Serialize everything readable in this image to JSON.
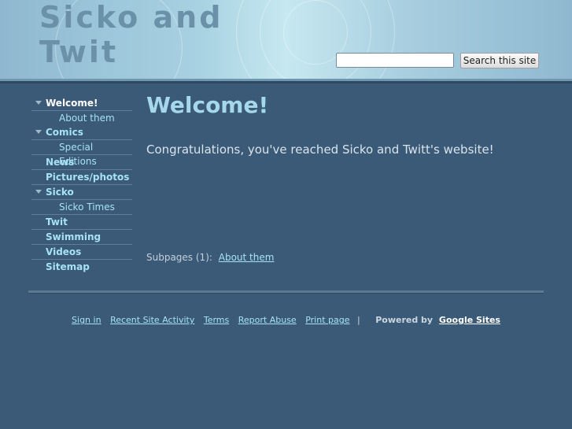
{
  "site": {
    "title": "Sicko and Twit"
  },
  "search": {
    "placeholder": "",
    "button_label": "Search this site"
  },
  "nav": {
    "items": [
      {
        "label": "Welcome!",
        "expanded": true
      },
      {
        "label": "About them"
      },
      {
        "label": "Comics",
        "expanded": true
      },
      {
        "label": "Special Editions"
      },
      {
        "label": "News"
      },
      {
        "label": "Pictures/photos"
      },
      {
        "label": "Sicko",
        "expanded": true
      },
      {
        "label": "Sicko Times"
      },
      {
        "label": "Twit"
      },
      {
        "label": "Swimming"
      },
      {
        "label": "Videos"
      },
      {
        "label": "Sitemap"
      }
    ]
  },
  "main": {
    "title": "Welcome!",
    "body": "Congratulations, you've reached Sicko and Twitt's website!",
    "subpages_label": "Subpages (1):",
    "subpages": [
      {
        "label": "About them"
      }
    ]
  },
  "footer": {
    "links": [
      "Sign in",
      "Recent Site Activity",
      "Terms",
      "Report Abuse",
      "Print page"
    ],
    "separator": "|",
    "powered_by": "Powered by",
    "powered_link": "Google Sites"
  },
  "colors": {
    "background": "#3b5a78",
    "link": "#a6e1f5",
    "title": "#a6d8ec",
    "header_title": "#6b91a8"
  }
}
